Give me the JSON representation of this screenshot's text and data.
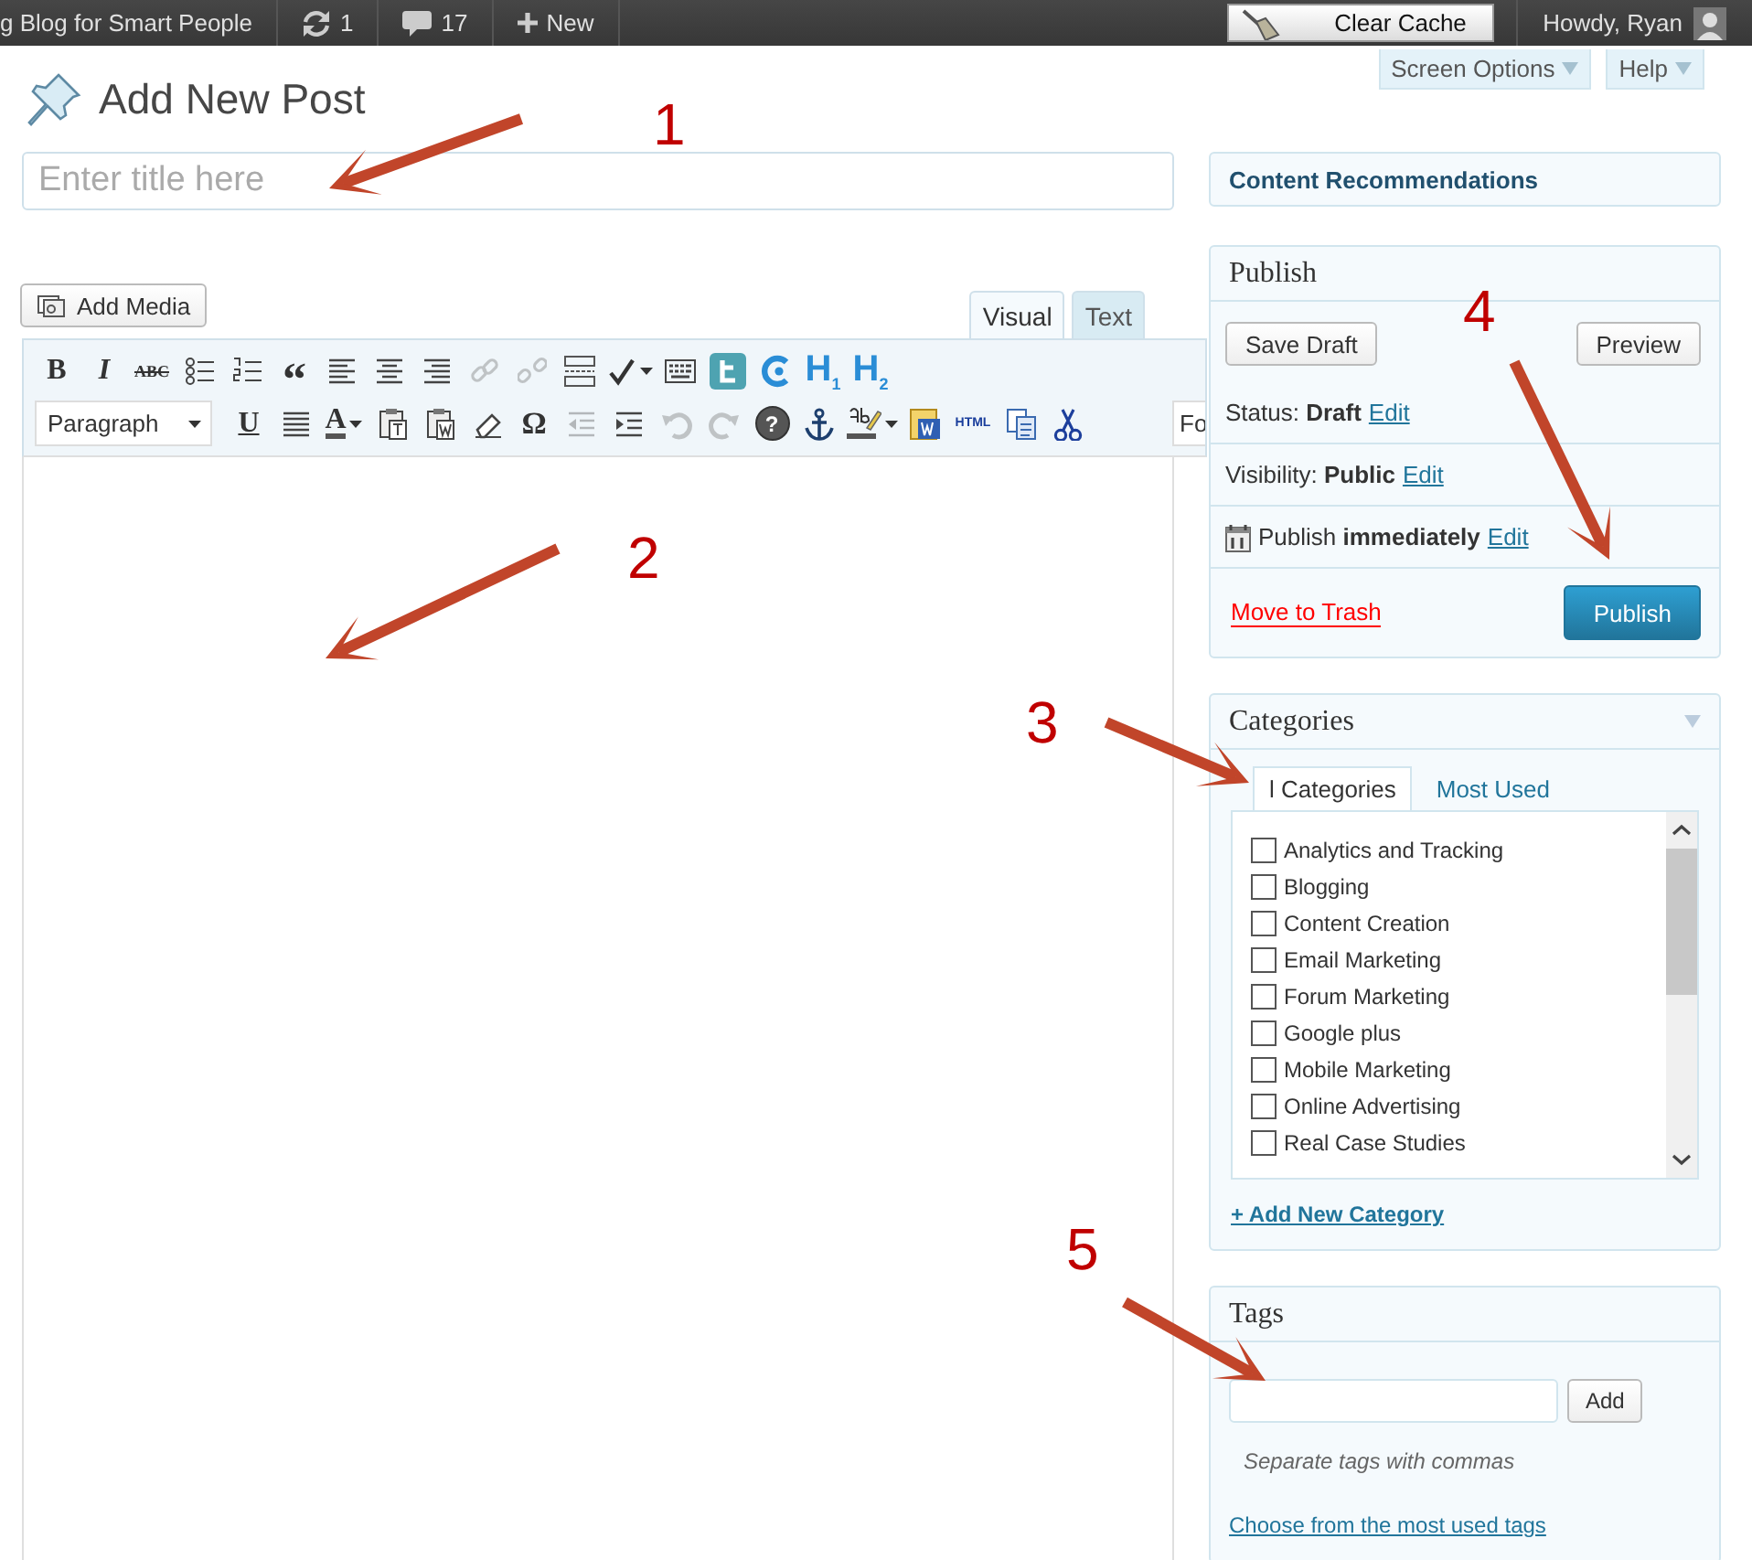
{
  "admin_bar": {
    "site_name": "g Blog for Smart People",
    "updates": "1",
    "comments": "17",
    "new_label": "New",
    "clear_cache": "Clear Cache",
    "greeting": "Howdy, Ryan"
  },
  "screen_tabs": [
    {
      "label": "Screen Options"
    },
    {
      "label": "Help"
    }
  ],
  "page_title": "Add New Post",
  "title_field": {
    "placeholder": "Enter title here"
  },
  "add_media": "Add Media",
  "editor_tabs": [
    {
      "label": "Visual",
      "selected": true
    },
    {
      "label": "Text",
      "selected": false
    }
  ],
  "toolbar": {
    "top_row": [
      {
        "kind": "glyph",
        "text": "B",
        "disabled": false
      },
      {
        "kind": "glyph",
        "text": "I",
        "disabled": false
      },
      {
        "kind": "glyph",
        "text": "ABC",
        "disabled": false
      },
      {
        "kind": "icon",
        "disabled": false
      },
      {
        "kind": "icon",
        "disabled": false
      },
      {
        "kind": "glyph",
        "text": "“",
        "disabled": false
      },
      {
        "kind": "icon",
        "disabled": false
      },
      {
        "kind": "icon",
        "disabled": false
      },
      {
        "kind": "icon",
        "disabled": false
      },
      {
        "kind": "icon",
        "disabled": true
      },
      {
        "kind": "icon",
        "disabled": true
      },
      {
        "kind": "icon",
        "disabled": false
      },
      {
        "kind": "icon",
        "disabled": false
      },
      {
        "kind": "icon",
        "disabled": false
      },
      {
        "kind": "icon",
        "disabled": false
      },
      {
        "kind": "icon",
        "disabled": false
      },
      {
        "kind": "glyph",
        "text": "H$_{1}$",
        "disabled": false
      },
      {
        "kind": "glyph",
        "text": "H$_{2}$",
        "disabled": false
      }
    ],
    "bottom_row": [
      {
        "kind": "select",
        "text": "Paragraph",
        "disabled": false
      },
      {
        "kind": "glyph",
        "text": "U",
        "disabled": false
      },
      {
        "kind": "icon",
        "disabled": false
      },
      {
        "kind": "glyph",
        "text": "A",
        "disabled": false
      },
      {
        "kind": "icon",
        "disabled": false
      },
      {
        "kind": "icon",
        "disabled": false
      },
      {
        "kind": "icon",
        "disabled": false
      },
      {
        "kind": "glyph",
        "text": "Ω",
        "disabled": false
      },
      {
        "kind": "icon",
        "disabled": true
      },
      {
        "kind": "icon",
        "disabled": false
      },
      {
        "kind": "icon",
        "disabled": true
      },
      {
        "kind": "icon",
        "disabled": true
      },
      {
        "kind": "glyph",
        "text": "?",
        "disabled": false
      },
      {
        "kind": "icon",
        "disabled": false
      },
      {
        "kind": "icon",
        "disabled": false
      },
      {
        "kind": "icon",
        "disabled": false
      },
      {
        "kind": "glyph",
        "text": "HTML",
        "disabled": false
      },
      {
        "kind": "icon",
        "disabled": false
      },
      {
        "kind": "icon",
        "disabled": false
      },
      {
        "kind": "field",
        "text": "Fo",
        "disabled": false
      }
    ]
  },
  "sidebar": {
    "content_recommendations": {
      "title": "Content Recommendations"
    },
    "publish": {
      "title": "Publish",
      "save_draft": "Save Draft",
      "preview": "Preview",
      "rows": [
        {
          "kind": "status",
          "text": "Status: **Draft**",
          "link": "Edit"
        },
        {
          "kind": "visibility",
          "text": "Visibility: **Public**",
          "link": "Edit"
        },
        {
          "kind": "schedule",
          "text": "Publish **immediately**",
          "link": "Edit"
        }
      ],
      "trash": "Move to Trash",
      "publish_button": "Publish"
    },
    "categories": {
      "title": "Categories",
      "tabs": [
        {
          "label": "l Categories",
          "selected": true
        },
        {
          "label": "Most Used",
          "selected": false
        }
      ],
      "items": [
        {
          "label": "Analytics and Tracking",
          "checked": false
        },
        {
          "label": "Blogging",
          "checked": false
        },
        {
          "label": "Content Creation",
          "checked": false
        },
        {
          "label": "Email Marketing",
          "checked": false
        },
        {
          "label": "Forum Marketing",
          "checked": false
        },
        {
          "label": "Google plus",
          "checked": false
        },
        {
          "label": "Mobile Marketing",
          "checked": false
        },
        {
          "label": "Online Advertising",
          "checked": false
        },
        {
          "label": "Real Case Studies",
          "checked": false
        }
      ],
      "add_link": "+ Add New Category"
    },
    "tags": {
      "title": "Tags",
      "add_button": "Add",
      "hint": "Separate tags with commas",
      "link": "Choose from the most used tags"
    }
  },
  "annotations": [
    {
      "label": "1"
    },
    {
      "label": "2"
    },
    {
      "label": "3"
    },
    {
      "label": "4"
    },
    {
      "label": "5"
    }
  ]
}
